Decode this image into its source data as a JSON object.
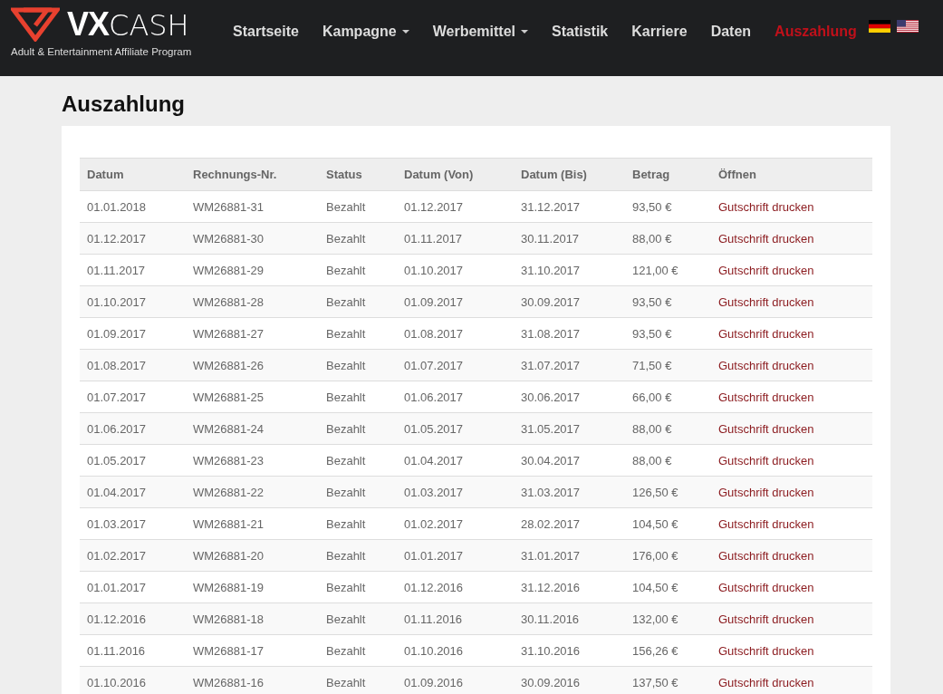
{
  "brand": {
    "strong": "VX",
    "light": "CASH",
    "tagline": "Adult & Entertainment Affiliate Program"
  },
  "nav": [
    {
      "label": "Startseite",
      "dropdown": false,
      "selected": false
    },
    {
      "label": "Kampagne",
      "dropdown": true,
      "selected": false
    },
    {
      "label": "Werbemittel",
      "dropdown": true,
      "selected": false
    },
    {
      "label": "Statistik",
      "dropdown": false,
      "selected": false
    },
    {
      "label": "Karriere",
      "dropdown": false,
      "selected": false
    },
    {
      "label": "Daten",
      "dropdown": false,
      "selected": false
    },
    {
      "label": "Auszahlung",
      "dropdown": false,
      "selected": true
    }
  ],
  "page_title": "Auszahlung",
  "table": {
    "columns": [
      "Datum",
      "Rechnungs-Nr.",
      "Status",
      "Datum (Von)",
      "Datum (Bis)",
      "Betrag",
      "Öffnen"
    ],
    "rows": [
      [
        "01.01.2018",
        "WM26881-31",
        "Bezahlt",
        "01.12.2017",
        "31.12.2017",
        "93,50 €",
        "Gutschrift drucken"
      ],
      [
        "01.12.2017",
        "WM26881-30",
        "Bezahlt",
        "01.11.2017",
        "30.11.2017",
        "88,00 €",
        "Gutschrift drucken"
      ],
      [
        "01.11.2017",
        "WM26881-29",
        "Bezahlt",
        "01.10.2017",
        "31.10.2017",
        "121,00 €",
        "Gutschrift drucken"
      ],
      [
        "01.10.2017",
        "WM26881-28",
        "Bezahlt",
        "01.09.2017",
        "30.09.2017",
        "93,50 €",
        "Gutschrift drucken"
      ],
      [
        "01.09.2017",
        "WM26881-27",
        "Bezahlt",
        "01.08.2017",
        "31.08.2017",
        "93,50 €",
        "Gutschrift drucken"
      ],
      [
        "01.08.2017",
        "WM26881-26",
        "Bezahlt",
        "01.07.2017",
        "31.07.2017",
        "71,50 €",
        "Gutschrift drucken"
      ],
      [
        "01.07.2017",
        "WM26881-25",
        "Bezahlt",
        "01.06.2017",
        "30.06.2017",
        "66,00 €",
        "Gutschrift drucken"
      ],
      [
        "01.06.2017",
        "WM26881-24",
        "Bezahlt",
        "01.05.2017",
        "31.05.2017",
        "88,00 €",
        "Gutschrift drucken"
      ],
      [
        "01.05.2017",
        "WM26881-23",
        "Bezahlt",
        "01.04.2017",
        "30.04.2017",
        "88,00 €",
        "Gutschrift drucken"
      ],
      [
        "01.04.2017",
        "WM26881-22",
        "Bezahlt",
        "01.03.2017",
        "31.03.2017",
        "126,50 €",
        "Gutschrift drucken"
      ],
      [
        "01.03.2017",
        "WM26881-21",
        "Bezahlt",
        "01.02.2017",
        "28.02.2017",
        "104,50 €",
        "Gutschrift drucken"
      ],
      [
        "01.02.2017",
        "WM26881-20",
        "Bezahlt",
        "01.01.2017",
        "31.01.2017",
        "176,00 €",
        "Gutschrift drucken"
      ],
      [
        "01.01.2017",
        "WM26881-19",
        "Bezahlt",
        "01.12.2016",
        "31.12.2016",
        "104,50 €",
        "Gutschrift drucken"
      ],
      [
        "01.12.2016",
        "WM26881-18",
        "Bezahlt",
        "01.11.2016",
        "30.11.2016",
        "132,00 €",
        "Gutschrift drucken"
      ],
      [
        "01.11.2016",
        "WM26881-17",
        "Bezahlt",
        "01.10.2016",
        "31.10.2016",
        "156,26 €",
        "Gutschrift drucken"
      ],
      [
        "01.10.2016",
        "WM26881-16",
        "Bezahlt",
        "01.09.2016",
        "30.09.2016",
        "137,50 €",
        "Gutschrift drucken"
      ]
    ]
  }
}
